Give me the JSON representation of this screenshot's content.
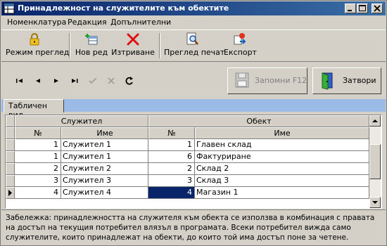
{
  "window": {
    "title": "Принадлежност на служителите към обектите"
  },
  "menu": [
    "Номенклатура",
    "Редакция",
    "Допълнителни"
  ],
  "toolbar": {
    "view_mode": "Режим преглед",
    "new_row": "Нов ред",
    "delete": "Изтриване",
    "print_preview": "Преглед печат",
    "export": "Експорт"
  },
  "actions": {
    "save": "Запомни  F12",
    "close": "Затвори"
  },
  "tab": {
    "label": "Табличен вид"
  },
  "grid": {
    "group_employee": "Служител",
    "group_object": "Обект",
    "col_num": "№",
    "col_name": "Име",
    "rows": [
      {
        "emp_no": "1",
        "emp_name": "Служител 1",
        "obj_no": "1",
        "obj_name": "Главен склад"
      },
      {
        "emp_no": "1",
        "emp_name": "Служител 1",
        "obj_no": "6",
        "obj_name": "Фактуриране"
      },
      {
        "emp_no": "2",
        "emp_name": "Служител 2",
        "obj_no": "2",
        "obj_name": "Склад 2"
      },
      {
        "emp_no": "3",
        "emp_name": "Служител 3",
        "obj_no": "3",
        "obj_name": "Склад 3"
      },
      {
        "emp_no": "4",
        "emp_name": "Служител 4",
        "obj_no": "4",
        "obj_name": "Магазин 1"
      }
    ],
    "current_row": 4
  },
  "note": "Забележка: принадлежността на служителя към обекта се използва в комбинация с правата на достъп на текущия потребител влязъл в програмата. Всеки потребител вижда само служителите, които принадлежат на обекти, до които той има достъп поне за четене."
}
